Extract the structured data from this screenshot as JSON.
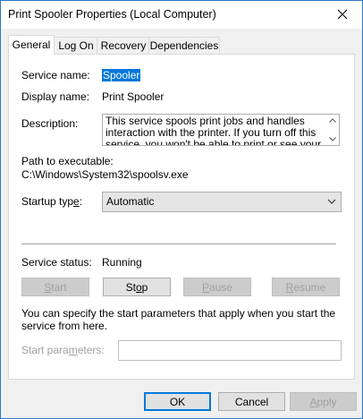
{
  "window": {
    "title": "Print Spooler Properties (Local Computer)"
  },
  "tabs": [
    {
      "label": "General"
    },
    {
      "label": "Log On"
    },
    {
      "label": "Recovery"
    },
    {
      "label": "Dependencies"
    }
  ],
  "general": {
    "service_name_label": "Service name:",
    "service_name_value": "Spooler",
    "display_name_label": "Display name:",
    "display_name_value": "Print Spooler",
    "description_label": "Description:",
    "description_value": "This service spools print jobs and handles interaction with the printer.  If you turn off this service, you won't be able to print or see your printers.",
    "path_label": "Path to executable:",
    "path_value": "C:\\Windows\\System32\\spoolsv.exe",
    "startup_type_label_pre": "Startup typ",
    "startup_type_label_u": "e",
    "startup_type_label_post": ":",
    "startup_type_value": "Automatic",
    "service_status_label": "Service status:",
    "service_status_value": "Running",
    "buttons": {
      "start_u": "S",
      "start_rest": "tart",
      "stop_pre": "St",
      "stop_u": "o",
      "stop_post": "p",
      "pause_u": "P",
      "pause_rest": "ause",
      "resume_u": "R",
      "resume_rest": "esume"
    },
    "start_params_info": "You can specify the start parameters that apply when you start the service from here.",
    "start_params_label_pre": "Start para",
    "start_params_label_u": "m",
    "start_params_label_post": "eters:",
    "start_params_value": ""
  },
  "footer": {
    "ok_label": "OK",
    "cancel_label": "Cancel",
    "apply_u": "A",
    "apply_rest": "pply"
  }
}
